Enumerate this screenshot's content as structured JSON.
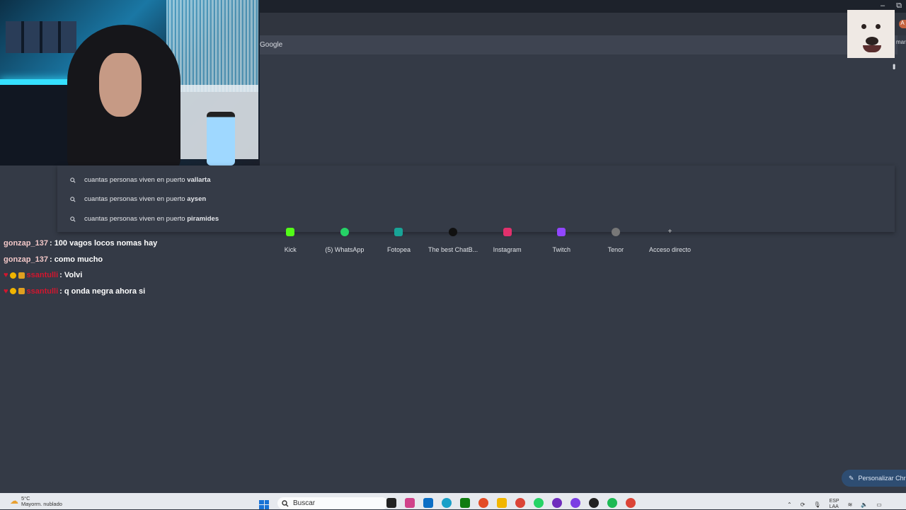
{
  "browser": {
    "search_engine_label": "Google",
    "window_controls": [
      "–",
      "⧉"
    ],
    "edge_letter": "A",
    "edge_text": "mar"
  },
  "suggestions": [
    {
      "prefix": "cuantas personas viven en puerto ",
      "completion": "vallarta"
    },
    {
      "prefix": "cuantas personas viven en puerto ",
      "completion": "aysen"
    },
    {
      "prefix": "cuantas personas viven en puerto ",
      "completion": "piramides"
    }
  ],
  "shortcuts": [
    {
      "label": "Kick",
      "color": "#53fc18"
    },
    {
      "label": "(5) WhatsApp",
      "color": "#25d366"
    },
    {
      "label": "Fotopea",
      "color": "#18a497"
    },
    {
      "label": "The best ChatB...",
      "color": "#111111"
    },
    {
      "label": "Instagram",
      "color": "#e1306c"
    },
    {
      "label": "Twitch",
      "color": "#9146ff"
    },
    {
      "label": "Tenor",
      "color": "#777777"
    },
    {
      "label": "Acceso directo",
      "color": "#cccccc"
    }
  ],
  "chat": [
    {
      "user": "gonzap_137",
      "message": ": 100 vagos locos nomas hay",
      "badges": false
    },
    {
      "user": "gonzap_137",
      "message": ": como mucho",
      "badges": false
    },
    {
      "user": "ssantulli",
      "message": ": Volvi",
      "badges": true
    },
    {
      "user": "ssantulli",
      "message": ": q onda negra ahora si",
      "badges": true
    }
  ],
  "customize_label": "Personalizar Chr",
  "taskbar": {
    "temperature": "5°C",
    "weather_desc": "Mayorm. nublado",
    "search_placeholder": "Buscar",
    "lang": "ESP",
    "lang_sub": "LAA",
    "app_colors": [
      "#8b8f5a",
      "#222222",
      "#d0428a",
      "#0b6ec5",
      "#1aa0c8",
      "#107c10",
      "#e34c26",
      "#f2b600",
      "#db4437",
      "#25d366",
      "#6f2dbd",
      "#7b3fe4",
      "#222222",
      "#1db954",
      "#db4437"
    ]
  },
  "colors": {
    "background": "#343a46",
    "chat_user_light": "#f3c8c8",
    "chat_user_red": "#d2162e"
  }
}
